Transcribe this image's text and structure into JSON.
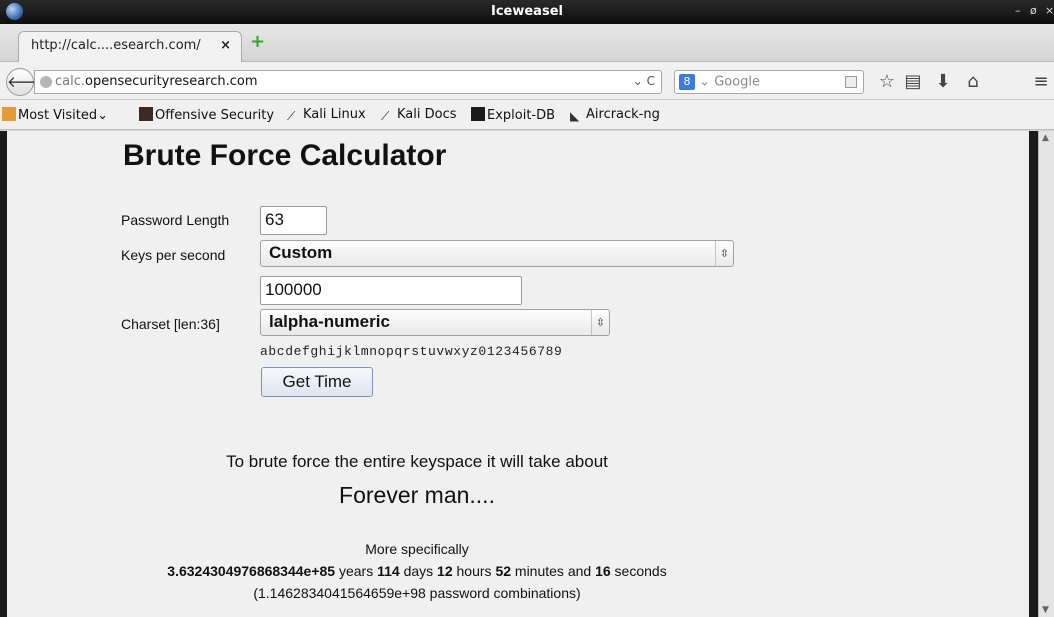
{
  "window": {
    "title": "Iceweasel",
    "controls": [
      "–",
      "ø",
      "×"
    ]
  },
  "tab": {
    "label": "http://calc....esearch.com/",
    "close": "×",
    "new_tab": "+"
  },
  "urlbar": {
    "prefix": "calc.",
    "domain": "opensecurityresearch.com",
    "controls": "⌄ C"
  },
  "search": {
    "engine": "8",
    "dropdown": "⌄",
    "placeholder": "Google"
  },
  "toolbar_icons": [
    "star-icon",
    "clipboard-icon",
    "download-icon",
    "home-icon",
    "menu-icon"
  ],
  "bookmarks": [
    {
      "label": "Most Visited⌄",
      "icon": "folder-icon"
    },
    {
      "label": "Offensive Security",
      "icon": "offsec-icon"
    },
    {
      "label": "Kali Linux",
      "icon": "kali-icon"
    },
    {
      "label": "Kali Docs",
      "icon": "kali-icon"
    },
    {
      "label": "Exploit-DB",
      "icon": "exploitdb-icon"
    },
    {
      "label": "Aircrack-ng",
      "icon": "aircrack-icon"
    }
  ],
  "calculator": {
    "title": "Brute Force Calculator",
    "password_length_label": "Password Length",
    "password_length_value": "63",
    "keys_per_second_label": "Keys per second",
    "keys_per_second_selected": "Custom",
    "keys_per_second_custom_value": "100000",
    "charset_label": "Charset [len:36]",
    "charset_selected": "lalpha-numeric",
    "charset_string": "abcdefghijklmnopqrstuvwxyz0123456789",
    "button_label": "Get Time"
  },
  "result": {
    "intro": "To brute force the entire keyspace it will take about",
    "headline": "Forever man....",
    "more_label": "More specifically",
    "years": "3.6324304976868344e+85",
    "years_unit": " years ",
    "days": "114",
    "days_unit": " days ",
    "hours": "12",
    "hours_unit": " hours ",
    "minutes": "52",
    "minutes_unit": " minutes and ",
    "seconds": "16",
    "seconds_unit": " seconds",
    "combinations": "(1.1462834041564659e+98 password combinations)"
  },
  "colors": {
    "title_bar": "#0e0e0e",
    "page_bg": "#f0f0f0",
    "button_border": "#7d95b8"
  }
}
